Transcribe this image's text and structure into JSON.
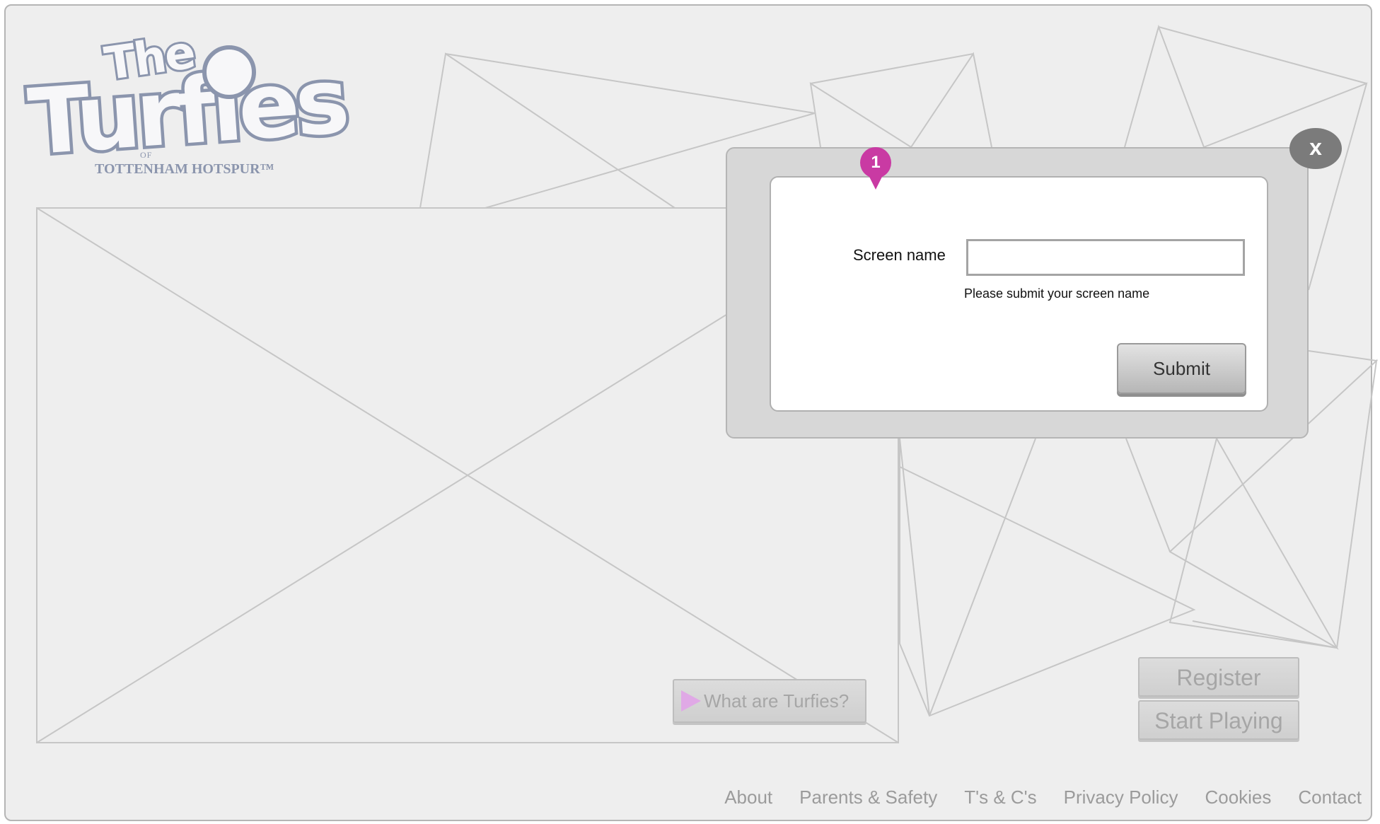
{
  "logo": {
    "word1": "The",
    "word2": "Turfies",
    "of": "OF",
    "club": "TOTTENHAM HOTSPUR™"
  },
  "video": {
    "label": "What are Turfies?"
  },
  "actions": {
    "register": "Register",
    "start": "Start Playing"
  },
  "footer": {
    "links": [
      "About",
      "Parents & Safety",
      "T's & C's",
      "Privacy Policy",
      "Cookies",
      "Contact"
    ]
  },
  "modal": {
    "close_label": "x",
    "marker": "1",
    "screen_name_label": "Screen name",
    "screen_name_value": "",
    "help_text": "Please submit your screen name",
    "submit_label": "Submit"
  },
  "colors": {
    "background": "#eeeeee",
    "logo": "#8b95ad",
    "marker": "#c93aa3",
    "play_icon": "#e0a9e6",
    "close_button": "#7b7b7b"
  }
}
